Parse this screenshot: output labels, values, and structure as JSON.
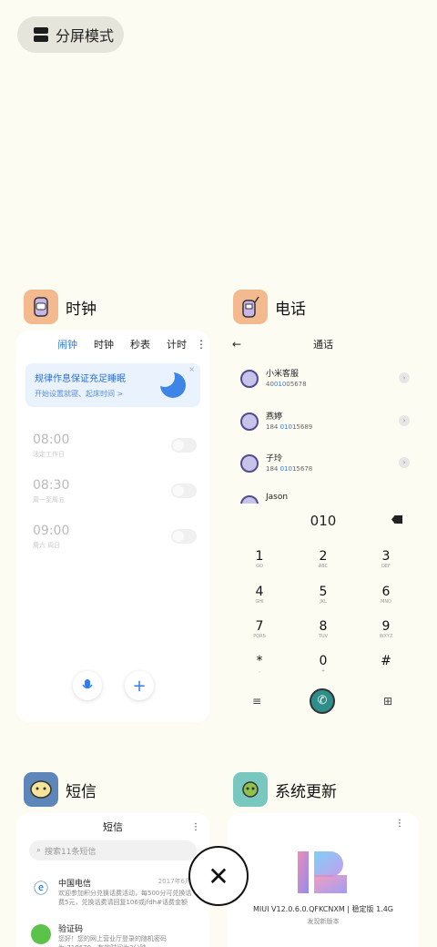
{
  "split_mode": {
    "label": "分屏模式"
  },
  "apps": {
    "clock": {
      "name": "时钟",
      "icon": "clock-app-icon",
      "color": "#f3b98f"
    },
    "phone": {
      "name": "电话",
      "icon": "phone-app-icon",
      "color": "#f3b98f"
    },
    "sms": {
      "name": "短信",
      "icon": "messages-app-icon",
      "color": "#5e86b8"
    },
    "update": {
      "name": "系统更新",
      "icon": "update-app-icon",
      "color": "#79c8c0"
    }
  },
  "clock": {
    "tabs": [
      "闹钟",
      "时钟",
      "秒表",
      "计时"
    ],
    "banner_title": "规律作息保证充足睡眠",
    "banner_sub": "开始设置就寝、起床时间 >",
    "alarms": [
      {
        "time": "08:00",
        "repeat": "法定工作日"
      },
      {
        "time": "08:30",
        "repeat": "周一至周五"
      },
      {
        "time": "09:00",
        "repeat": "周六 周日"
      }
    ]
  },
  "phone": {
    "title": "通话",
    "contacts": [
      {
        "name": "小米客服",
        "num_pre": "40",
        "num_hit": "010",
        "num_post": "05678"
      },
      {
        "name": "燕婷",
        "num_pre": "184 ",
        "num_hit": "010",
        "num_post": "15689"
      },
      {
        "name": "子玲",
        "num_pre": "184 ",
        "num_hit": "010",
        "num_post": "15678"
      },
      {
        "name": "Jason",
        "num_pre": "",
        "num_hit": "",
        "num_post": ""
      }
    ],
    "dialed": "010",
    "keys": [
      {
        "d": "1",
        "l": "GO"
      },
      {
        "d": "2",
        "l": "ABC"
      },
      {
        "d": "3",
        "l": "DEF"
      },
      {
        "d": "4",
        "l": "GHI"
      },
      {
        "d": "5",
        "l": "JKL"
      },
      {
        "d": "6",
        "l": "MNO"
      },
      {
        "d": "7",
        "l": "PQRS"
      },
      {
        "d": "8",
        "l": "TUV"
      },
      {
        "d": "9",
        "l": "WXYZ"
      },
      {
        "d": "*",
        "l": ","
      },
      {
        "d": "0",
        "l": "+"
      },
      {
        "d": "#",
        "l": ""
      }
    ]
  },
  "sms": {
    "title": "短信",
    "search_placeholder": "搜索11条短信",
    "messages": [
      {
        "name": "中国电信",
        "time": "2017年6月",
        "body": "欢迎参加积分兑换话费活动，每500分可兑换话费5元，兑换话费请回复106或jfdh#话费金额",
        "color": "#1a6cc0"
      },
      {
        "name": "验证码",
        "time": "",
        "body": "您好！您的网上营业厅登录的随机密码为:710679，有效时间为3分钟",
        "color": "#5bc34a"
      }
    ]
  },
  "update": {
    "version": "MIUI V12.0.6.0.QFKCNXM | 稳定版 1.4G",
    "status": "发现新版本"
  }
}
